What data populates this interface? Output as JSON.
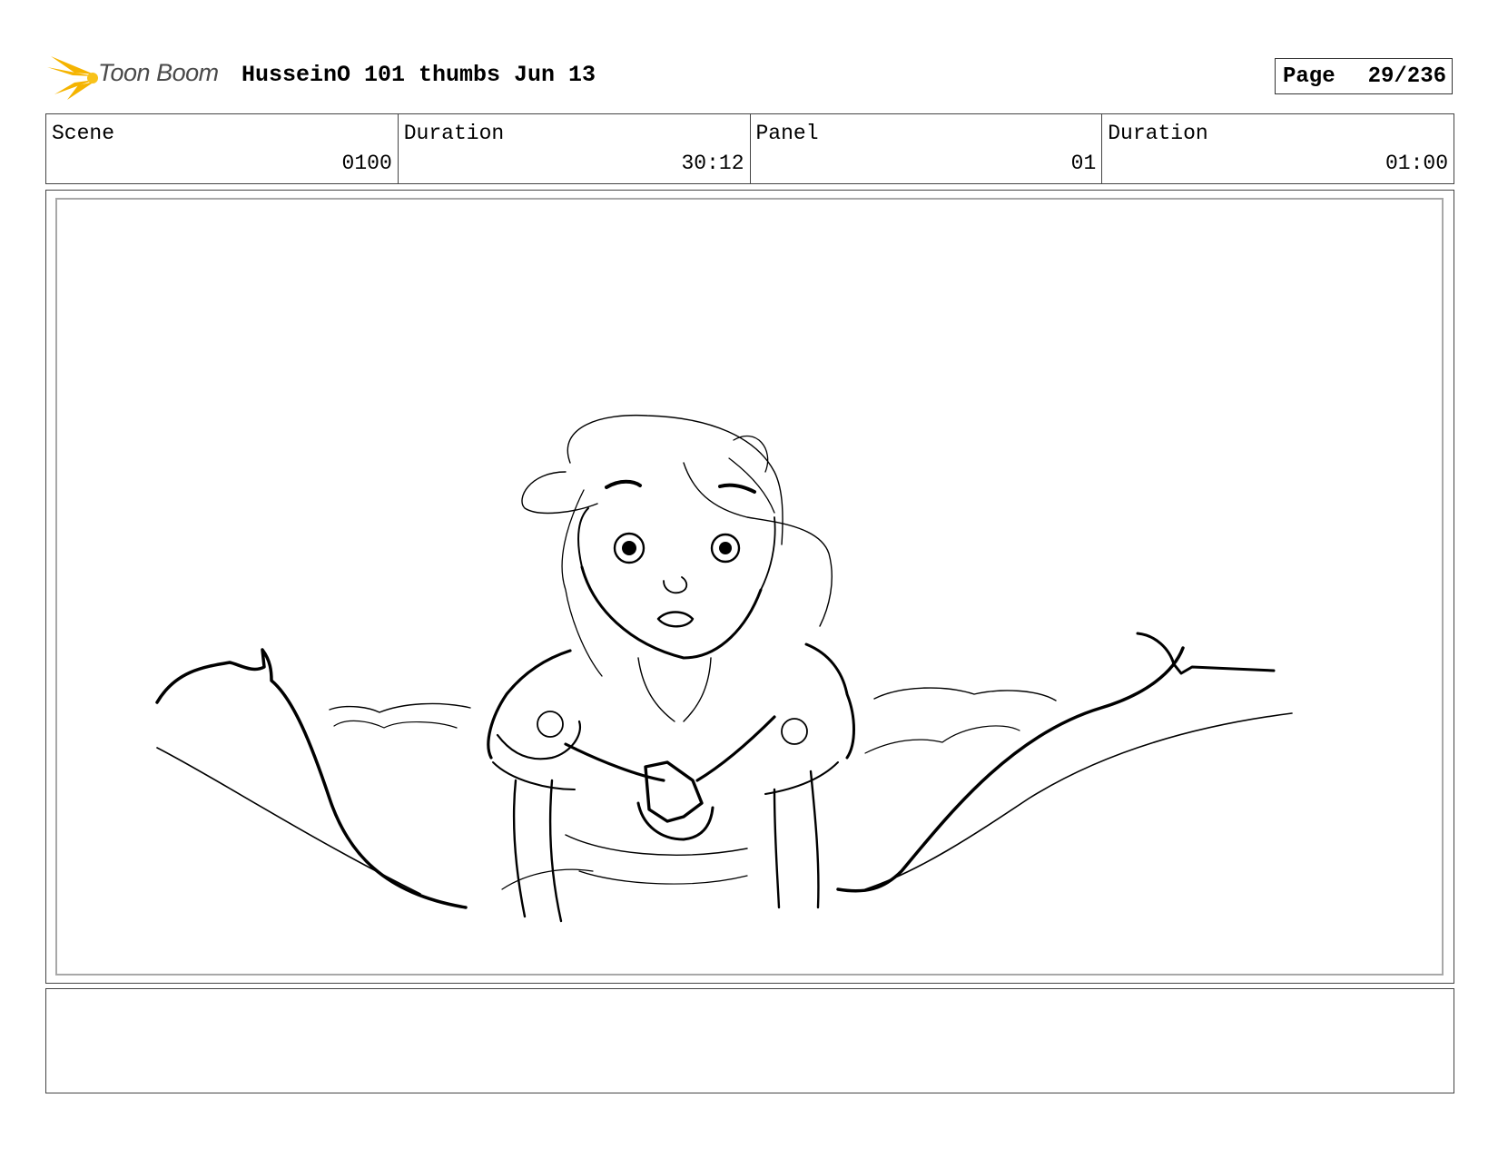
{
  "header": {
    "logo_text": "Toon Boom",
    "doc_title": "HusseinO 101 thumbs Jun 13",
    "page_label": "Page",
    "page_number": "29/236"
  },
  "info": {
    "scene_label": "Scene",
    "scene_value": "0100",
    "scene_duration_label": "Duration",
    "scene_duration_value": "30:12",
    "panel_label": "Panel",
    "panel_value": "01",
    "panel_duration_label": "Duration",
    "panel_duration_value": "01:00"
  },
  "panel": {
    "image": "sketch-girl-with-cape-and-clouds"
  },
  "notes": {
    "text": ""
  },
  "colors": {
    "logo_burst": "#f5b400",
    "logo_text": "#4a4a4a",
    "panel_border": "#a8a8a8"
  }
}
